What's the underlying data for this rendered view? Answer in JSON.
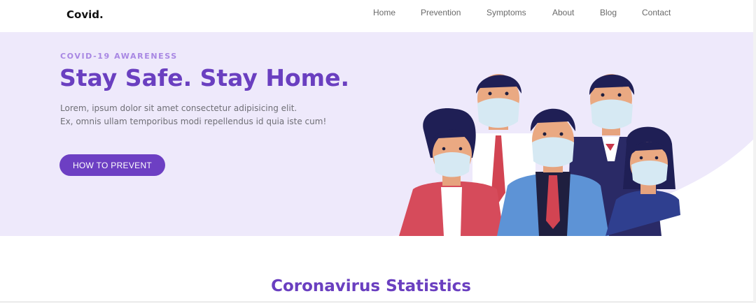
{
  "nav": {
    "logo": "Covid.",
    "links": [
      "Home",
      "Prevention",
      "Symptoms",
      "About",
      "Blog",
      "Contact"
    ]
  },
  "hero": {
    "eyebrow": "COVID-19 AWARENESS",
    "title": "Stay Safe. Stay Home.",
    "text_line1": "Lorem, ipsum dolor sit amet consectetur adipisicing elit.",
    "text_line2": "Ex, omnis ullam temporibus modi repellendus id quia iste cum!",
    "button": "HOW TO PREVENT"
  },
  "stats": {
    "title": "Coronavirus Statistics"
  },
  "colors": {
    "accent": "#6a3fc0",
    "hero_bg": "#eee9fb",
    "eyebrow": "#a887e3"
  },
  "icons": {
    "illustration": "masked-people-illustration"
  }
}
